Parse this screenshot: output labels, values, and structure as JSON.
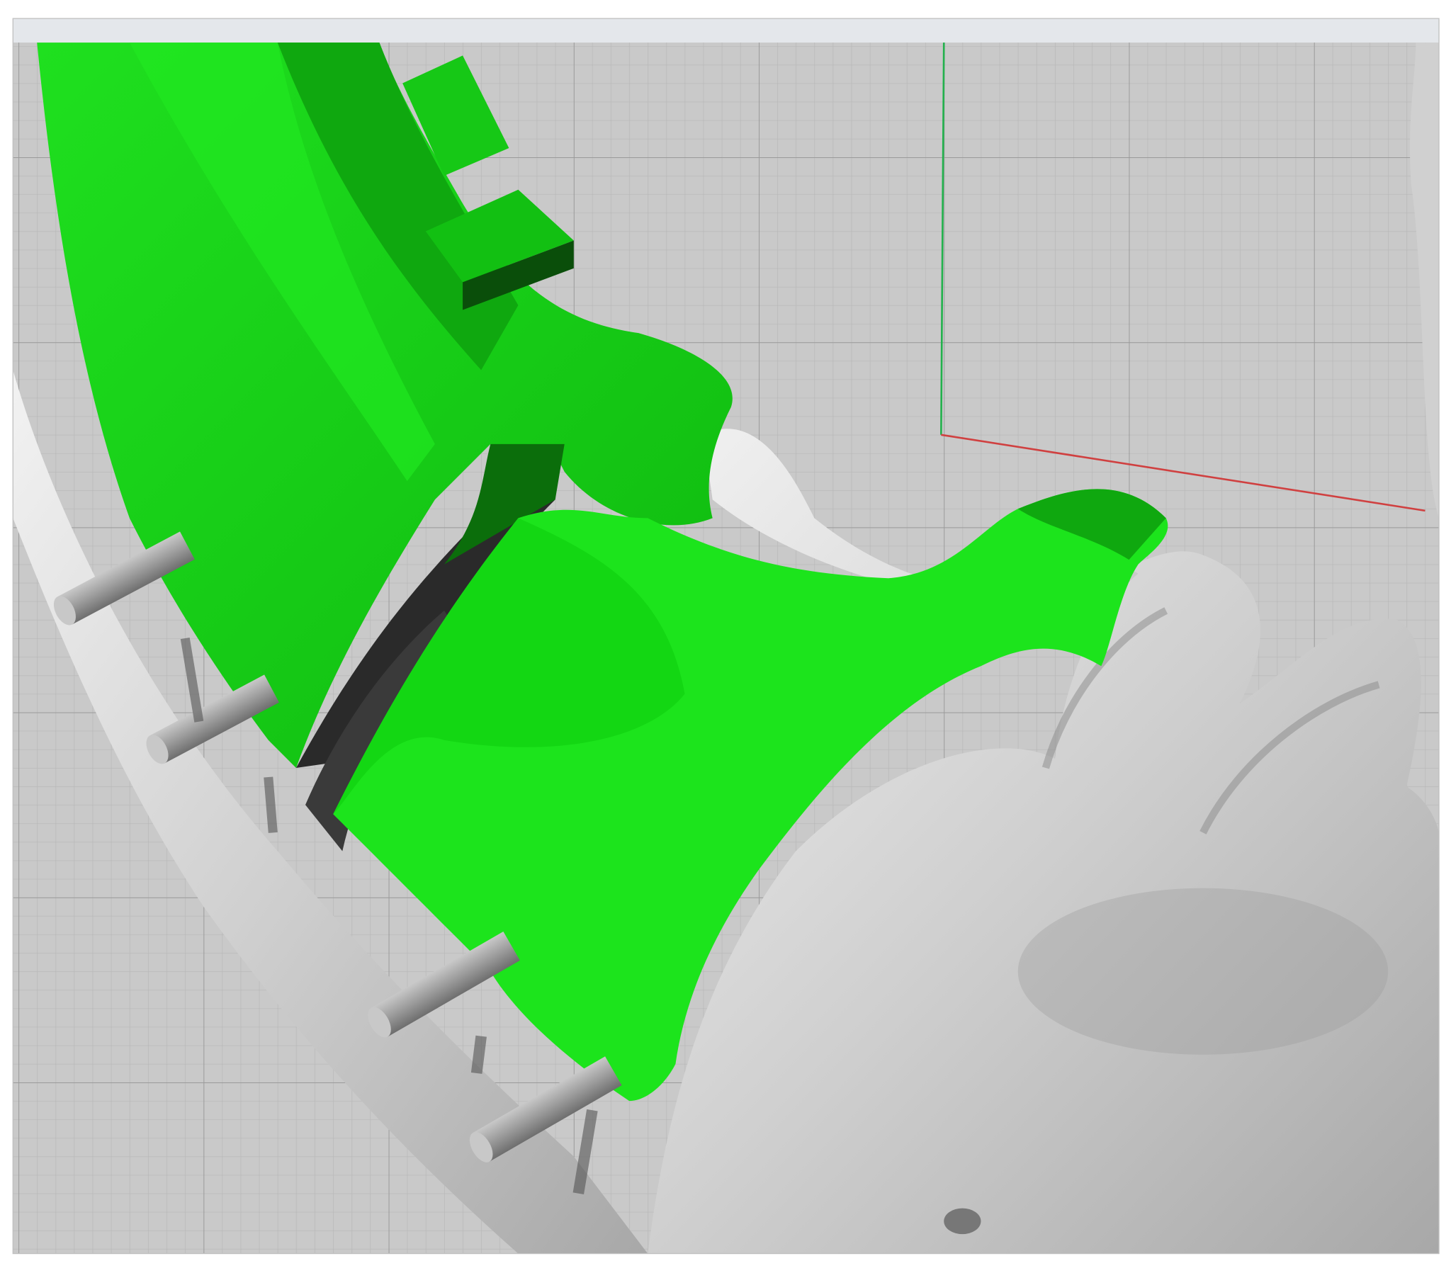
{
  "window": {
    "title_bar_color": "#e4e7eb"
  },
  "viewport": {
    "background": "#c9c9c9",
    "grid_color": "#b4b4b4",
    "major_grid_color": "#9a9a9a",
    "axes": [
      {
        "name": "y-axis",
        "color": "#22b14c"
      },
      {
        "name": "x-axis",
        "color": "#d04040"
      }
    ],
    "objects": {
      "surgical_guide_color": "#16d616",
      "mandible_color": "#d6d6d6",
      "pin_color": "#9a9a9a",
      "pin_count": 4
    }
  },
  "icons": [
    "surgical-guide-model-icon",
    "mandible-model-icon",
    "fixation-pin-icon"
  ]
}
